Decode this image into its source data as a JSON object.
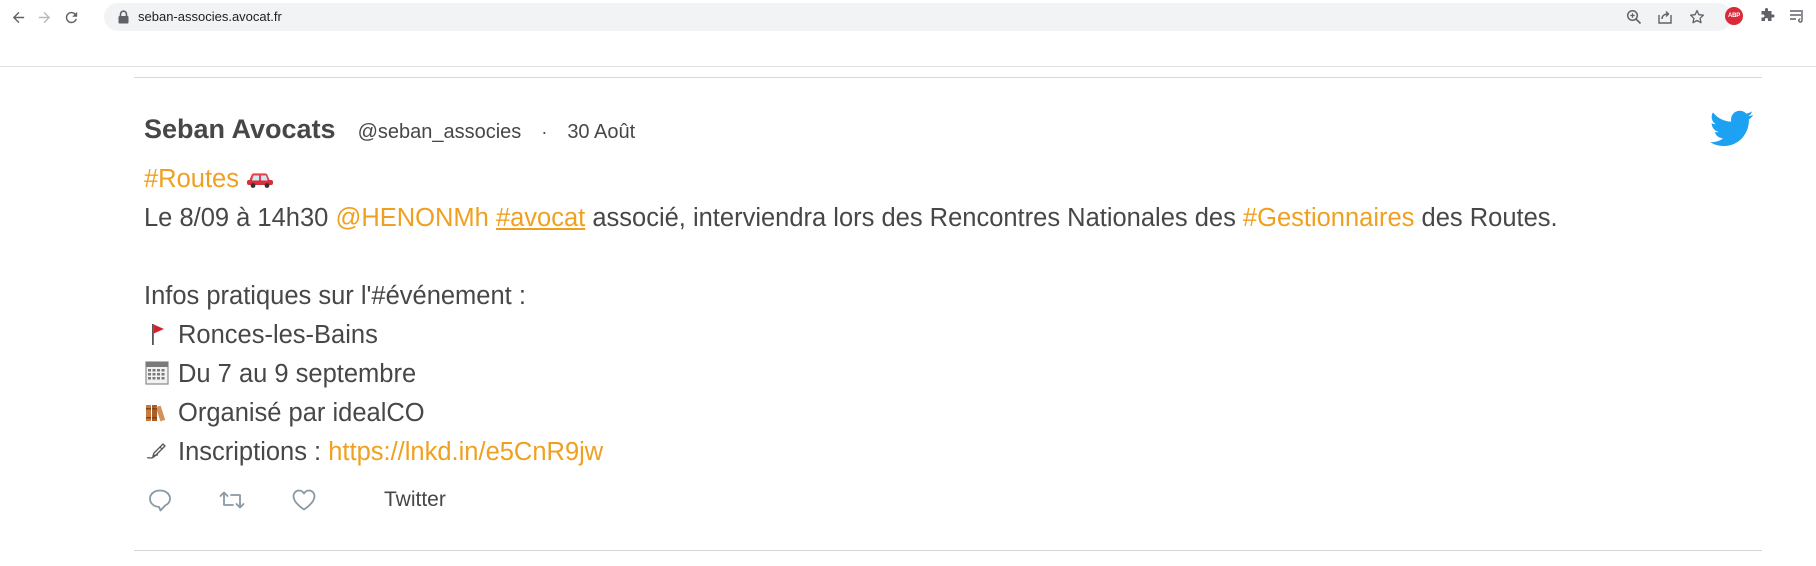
{
  "browser": {
    "url": "seban-associes.avocat.fr",
    "icons": [
      "back-icon",
      "forward-icon",
      "reload-icon",
      "lock-icon",
      "zoom-icon",
      "share-icon",
      "star-icon",
      "adblock-icon",
      "extensions-icon",
      "reading-list-icon"
    ],
    "adblock_label": "ABP"
  },
  "tweet": {
    "author_name": "Seban Avocats",
    "handle": "@seban_associes",
    "separator": "·",
    "date": "30 Août",
    "hashtag_routes": "#Routes",
    "line1": {
      "prefix": "Le 8/09 à 14h30 ",
      "mention": "@HENONMh",
      "hashtag_avocat": "#avocat",
      "middle": " associé, interviendra lors des Rencontres Nationales des ",
      "hashtag_gestionnaires": "#Gestionnaires",
      "suffix": " des Routes."
    },
    "info_title": "Infos pratiques sur l'#événement :",
    "location": "Ronces-les-Bains",
    "dates": "Du 7 au 9 septembre",
    "organizer": "Organisé par idealCO",
    "registration_label": "Inscriptions : ",
    "registration_link": "https://lnkd.in/e5CnR9jw",
    "twitter_label": "Twitter",
    "accent_color": "#f0a020",
    "text_color": "#474747",
    "brand_color": "#1da1f2"
  }
}
